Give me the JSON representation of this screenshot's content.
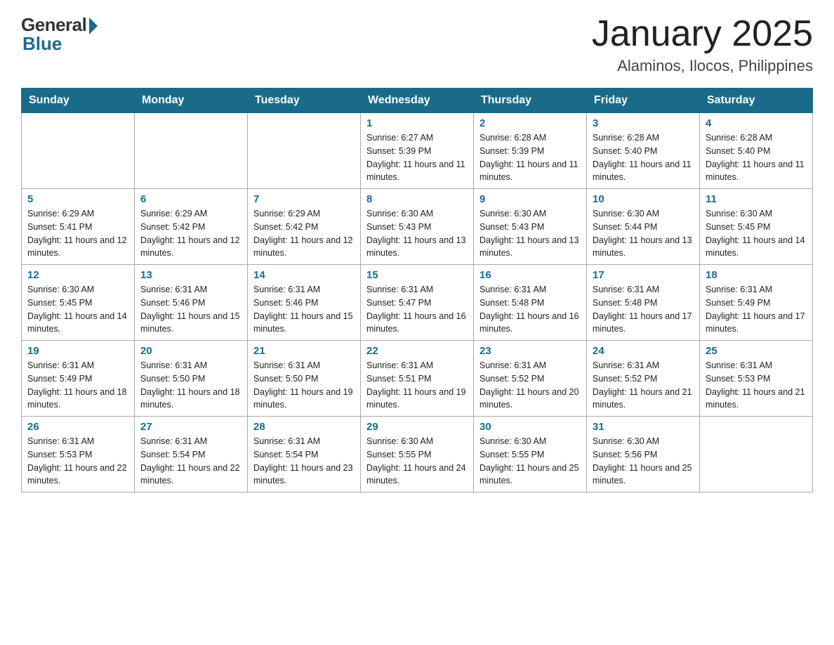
{
  "logo": {
    "general": "General",
    "blue": "Blue"
  },
  "title": {
    "month_year": "January 2025",
    "location": "Alaminos, Ilocos, Philippines"
  },
  "headers": [
    "Sunday",
    "Monday",
    "Tuesday",
    "Wednesday",
    "Thursday",
    "Friday",
    "Saturday"
  ],
  "weeks": [
    [
      {
        "day": "",
        "info": ""
      },
      {
        "day": "",
        "info": ""
      },
      {
        "day": "",
        "info": ""
      },
      {
        "day": "1",
        "info": "Sunrise: 6:27 AM\nSunset: 5:39 PM\nDaylight: 11 hours and 11 minutes."
      },
      {
        "day": "2",
        "info": "Sunrise: 6:28 AM\nSunset: 5:39 PM\nDaylight: 11 hours and 11 minutes."
      },
      {
        "day": "3",
        "info": "Sunrise: 6:28 AM\nSunset: 5:40 PM\nDaylight: 11 hours and 11 minutes."
      },
      {
        "day": "4",
        "info": "Sunrise: 6:28 AM\nSunset: 5:40 PM\nDaylight: 11 hours and 11 minutes."
      }
    ],
    [
      {
        "day": "5",
        "info": "Sunrise: 6:29 AM\nSunset: 5:41 PM\nDaylight: 11 hours and 12 minutes."
      },
      {
        "day": "6",
        "info": "Sunrise: 6:29 AM\nSunset: 5:42 PM\nDaylight: 11 hours and 12 minutes."
      },
      {
        "day": "7",
        "info": "Sunrise: 6:29 AM\nSunset: 5:42 PM\nDaylight: 11 hours and 12 minutes."
      },
      {
        "day": "8",
        "info": "Sunrise: 6:30 AM\nSunset: 5:43 PM\nDaylight: 11 hours and 13 minutes."
      },
      {
        "day": "9",
        "info": "Sunrise: 6:30 AM\nSunset: 5:43 PM\nDaylight: 11 hours and 13 minutes."
      },
      {
        "day": "10",
        "info": "Sunrise: 6:30 AM\nSunset: 5:44 PM\nDaylight: 11 hours and 13 minutes."
      },
      {
        "day": "11",
        "info": "Sunrise: 6:30 AM\nSunset: 5:45 PM\nDaylight: 11 hours and 14 minutes."
      }
    ],
    [
      {
        "day": "12",
        "info": "Sunrise: 6:30 AM\nSunset: 5:45 PM\nDaylight: 11 hours and 14 minutes."
      },
      {
        "day": "13",
        "info": "Sunrise: 6:31 AM\nSunset: 5:46 PM\nDaylight: 11 hours and 15 minutes."
      },
      {
        "day": "14",
        "info": "Sunrise: 6:31 AM\nSunset: 5:46 PM\nDaylight: 11 hours and 15 minutes."
      },
      {
        "day": "15",
        "info": "Sunrise: 6:31 AM\nSunset: 5:47 PM\nDaylight: 11 hours and 16 minutes."
      },
      {
        "day": "16",
        "info": "Sunrise: 6:31 AM\nSunset: 5:48 PM\nDaylight: 11 hours and 16 minutes."
      },
      {
        "day": "17",
        "info": "Sunrise: 6:31 AM\nSunset: 5:48 PM\nDaylight: 11 hours and 17 minutes."
      },
      {
        "day": "18",
        "info": "Sunrise: 6:31 AM\nSunset: 5:49 PM\nDaylight: 11 hours and 17 minutes."
      }
    ],
    [
      {
        "day": "19",
        "info": "Sunrise: 6:31 AM\nSunset: 5:49 PM\nDaylight: 11 hours and 18 minutes."
      },
      {
        "day": "20",
        "info": "Sunrise: 6:31 AM\nSunset: 5:50 PM\nDaylight: 11 hours and 18 minutes."
      },
      {
        "day": "21",
        "info": "Sunrise: 6:31 AM\nSunset: 5:50 PM\nDaylight: 11 hours and 19 minutes."
      },
      {
        "day": "22",
        "info": "Sunrise: 6:31 AM\nSunset: 5:51 PM\nDaylight: 11 hours and 19 minutes."
      },
      {
        "day": "23",
        "info": "Sunrise: 6:31 AM\nSunset: 5:52 PM\nDaylight: 11 hours and 20 minutes."
      },
      {
        "day": "24",
        "info": "Sunrise: 6:31 AM\nSunset: 5:52 PM\nDaylight: 11 hours and 21 minutes."
      },
      {
        "day": "25",
        "info": "Sunrise: 6:31 AM\nSunset: 5:53 PM\nDaylight: 11 hours and 21 minutes."
      }
    ],
    [
      {
        "day": "26",
        "info": "Sunrise: 6:31 AM\nSunset: 5:53 PM\nDaylight: 11 hours and 22 minutes."
      },
      {
        "day": "27",
        "info": "Sunrise: 6:31 AM\nSunset: 5:54 PM\nDaylight: 11 hours and 22 minutes."
      },
      {
        "day": "28",
        "info": "Sunrise: 6:31 AM\nSunset: 5:54 PM\nDaylight: 11 hours and 23 minutes."
      },
      {
        "day": "29",
        "info": "Sunrise: 6:30 AM\nSunset: 5:55 PM\nDaylight: 11 hours and 24 minutes."
      },
      {
        "day": "30",
        "info": "Sunrise: 6:30 AM\nSunset: 5:55 PM\nDaylight: 11 hours and 25 minutes."
      },
      {
        "day": "31",
        "info": "Sunrise: 6:30 AM\nSunset: 5:56 PM\nDaylight: 11 hours and 25 minutes."
      },
      {
        "day": "",
        "info": ""
      }
    ]
  ]
}
